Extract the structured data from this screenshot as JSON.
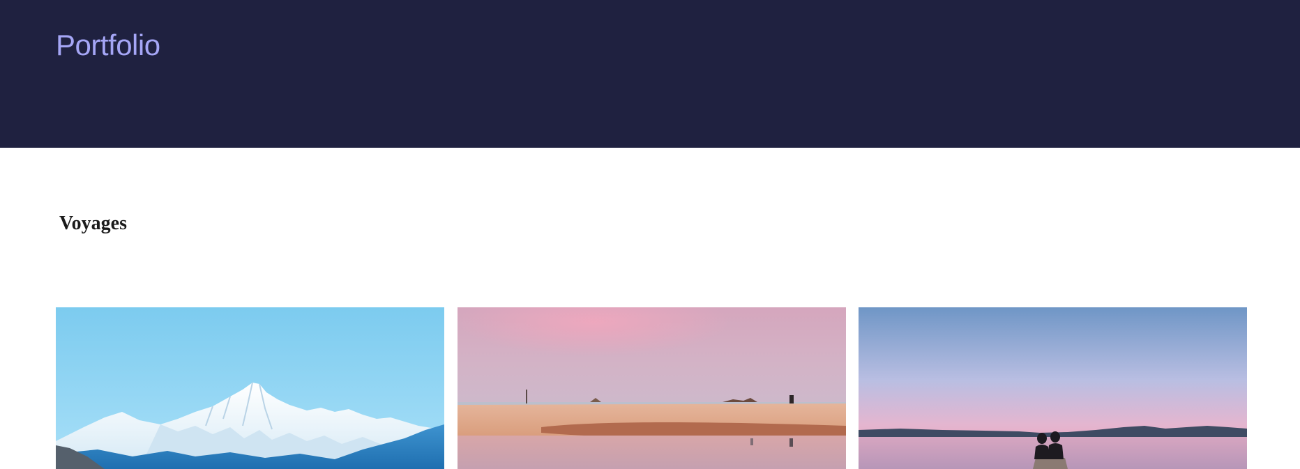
{
  "header": {
    "logo_text": "Portfolio",
    "background_color": "#1f2140",
    "logo_color": "#a5a6f6"
  },
  "main": {
    "section_title": "Voyages"
  },
  "gallery": {
    "items": [
      {
        "subject": "snowy-mountain-peaks-blue-sky"
      },
      {
        "subject": "sandy-beach-pink-sunset-reflection"
      },
      {
        "subject": "couple-on-pier-lake-twilight"
      }
    ]
  }
}
